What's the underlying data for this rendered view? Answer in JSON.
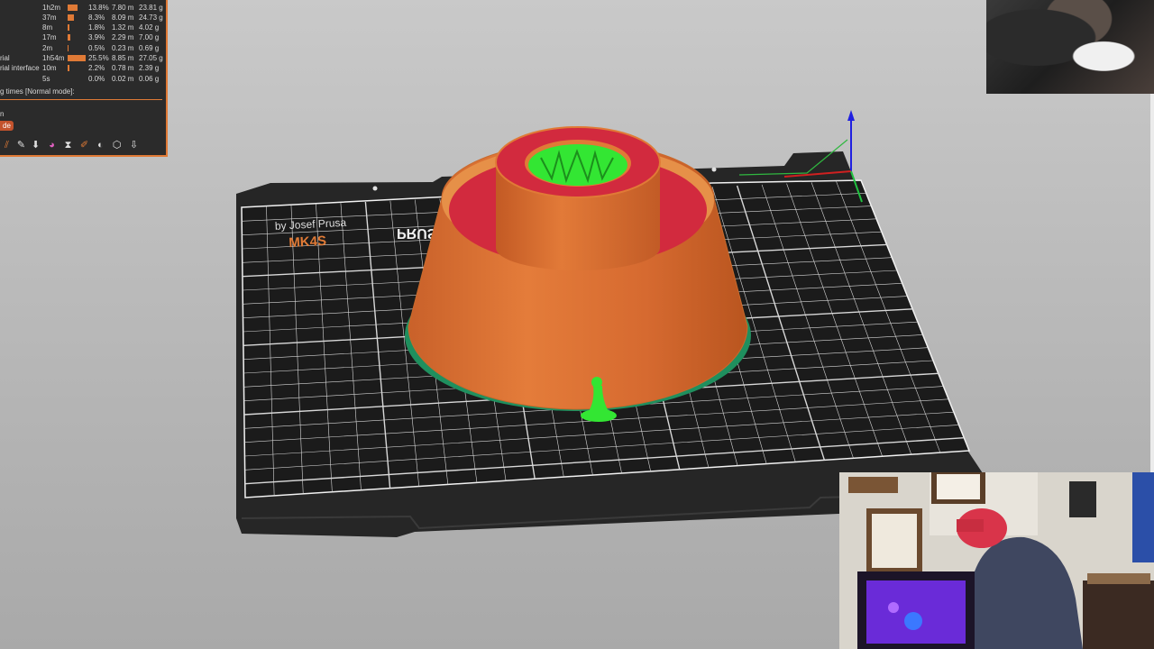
{
  "legend": {
    "rows": [
      {
        "name": "",
        "time": "1h2m",
        "bar": 0.14,
        "pct": "13.8%",
        "len": "7.80 m",
        "wt": "23.81 g"
      },
      {
        "name": "",
        "time": "37m",
        "bar": 0.09,
        "pct": "8.3%",
        "len": "8.09 m",
        "wt": "24.73 g"
      },
      {
        "name": "",
        "time": "8m",
        "bar": 0.02,
        "pct": "1.8%",
        "len": "1.32 m",
        "wt": "4.02 g"
      },
      {
        "name": "",
        "time": "17m",
        "bar": 0.04,
        "pct": "3.9%",
        "len": "2.29 m",
        "wt": "7.00 g"
      },
      {
        "name": "",
        "time": "2m",
        "bar": 0.005,
        "pct": "0.5%",
        "len": "0.23 m",
        "wt": "0.69 g"
      },
      {
        "name": "rial",
        "time": "1h54m",
        "bar": 0.255,
        "pct": "25.5%",
        "len": "8.85 m",
        "wt": "27.05 g"
      },
      {
        "name": "rial interface",
        "time": "10m",
        "bar": 0.022,
        "pct": "2.2%",
        "len": "0.78 m",
        "wt": "2.39 g"
      },
      {
        "name": "",
        "time": "5s",
        "bar": 0.0,
        "pct": "0.0%",
        "len": "0.02 m",
        "wt": "0.06 g"
      }
    ],
    "times_label": "g times [Normal mode]:",
    "view_label": "n",
    "mode_button": "de"
  },
  "toolbar_icons": [
    "layers-icon",
    "seam-icon",
    "retract-icon",
    "color-print-icon",
    "pause-icon",
    "tool-change-icon",
    "custom-gcode-icon",
    "sequential-icon",
    "cube-icon",
    "export-icon"
  ],
  "bed": {
    "brand": "PRUSA",
    "model": "MK4S",
    "maker": "by Josef Prusa"
  },
  "colors": {
    "perimeter": "#e07a36",
    "solid_infill": "#d22a3e",
    "support": "#33e633",
    "skirt": "#1f8f5e",
    "accent": "#e07a36"
  }
}
